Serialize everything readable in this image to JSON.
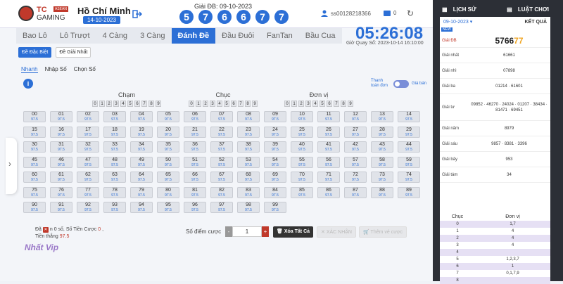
{
  "header": {
    "brand": "TC",
    "brand_badge": "ASEAN",
    "brand_sub": "GAMING",
    "region": "Hồ Chí Minh",
    "region_date": "14-10-2023",
    "draw_label": "Giải ĐB: 09-10-2023",
    "balls": [
      "5",
      "7",
      "6",
      "6",
      "7",
      "7"
    ],
    "username": "ss00128218366",
    "balance": "0"
  },
  "tabs": [
    "Bao Lô",
    "Lô Trượt",
    "4 Càng",
    "3 Càng",
    "Đánh Đề",
    "Đầu Đuôi",
    "FanTan",
    "Bầu Cua"
  ],
  "active_tab": 4,
  "clock": "05:26:08",
  "next_draw": "Giờ Quay Số: 2023-10-14 16:10:00",
  "subtabs": [
    "Đề Đặc Biệt",
    "Đề Giải Nhất"
  ],
  "modes": [
    "Nhanh",
    "Nhập Số",
    "Chọn Số"
  ],
  "pay_options": {
    "left": "Thanh toán đơn",
    "right": "Giá bán"
  },
  "pick_groups": [
    {
      "title": "Chạm",
      "digits": [
        "0",
        "1",
        "2",
        "3",
        "4",
        "5",
        "6",
        "7",
        "8",
        "9"
      ]
    },
    {
      "title": "Chục",
      "digits": [
        "0",
        "1",
        "2",
        "3",
        "4",
        "5",
        "6",
        "7",
        "8",
        "9"
      ]
    },
    {
      "title": "Đơn vị",
      "digits": [
        "0",
        "1",
        "2",
        "3",
        "4",
        "5",
        "6",
        "7",
        "8",
        "9"
      ]
    }
  ],
  "odds": "97.5",
  "footer": {
    "summary_prefix": "Đã",
    "summary_mid": "n 0 số,  Số Tiền Cược",
    "amount": "0",
    "win_label": "Tiền thắng",
    "win_value": "97.5",
    "points_label": "Số điểm cược",
    "stepper_value": "1",
    "clear_label": "Xóa Tất Cả",
    "confirm_label": "XÁC NHẬN",
    "cart_label": "Thêm vé cược"
  },
  "watermark": "Nhất Vip",
  "side": {
    "history_label": "LỊCH SỬ",
    "rules_label": "LUẬT CHƠI",
    "date": "09-10-2023",
    "title": "KẾT QUẢ",
    "news": "NEW",
    "results": [
      {
        "label": "Giải ĐB",
        "value_main": "5766",
        "value_hl": "77",
        "db": true
      },
      {
        "label": "Giải nhất",
        "value": "61661"
      },
      {
        "label": "Giải nhì",
        "value": "07898"
      },
      {
        "label": "Giải ba",
        "value": "01214 · 61601"
      },
      {
        "label": "Giải tư",
        "value": "09852 · 46270 · 24024 · 01207 · 38434 · 81471 · 69451"
      },
      {
        "label": "Giải năm",
        "value": "8979"
      },
      {
        "label": "Giải sáu",
        "value": "9857 · 8381 · 3396"
      },
      {
        "label": "Giải bảy",
        "value": "953"
      },
      {
        "label": "Giải tám",
        "value": "34"
      }
    ],
    "loto_head": {
      "tens": "Chục",
      "units": "Đơn vị"
    },
    "loto": [
      {
        "h": "0",
        "u": "1,7"
      },
      {
        "h": "1",
        "u": "4"
      },
      {
        "h": "2",
        "u": "4"
      },
      {
        "h": "3",
        "u": "4"
      },
      {
        "h": "4",
        "u": ""
      },
      {
        "h": "5",
        "u": "1,2,3,7"
      },
      {
        "h": "6",
        "u": "1"
      },
      {
        "h": "7",
        "u": "0,1,7,9"
      },
      {
        "h": "8",
        "u": ""
      }
    ]
  }
}
